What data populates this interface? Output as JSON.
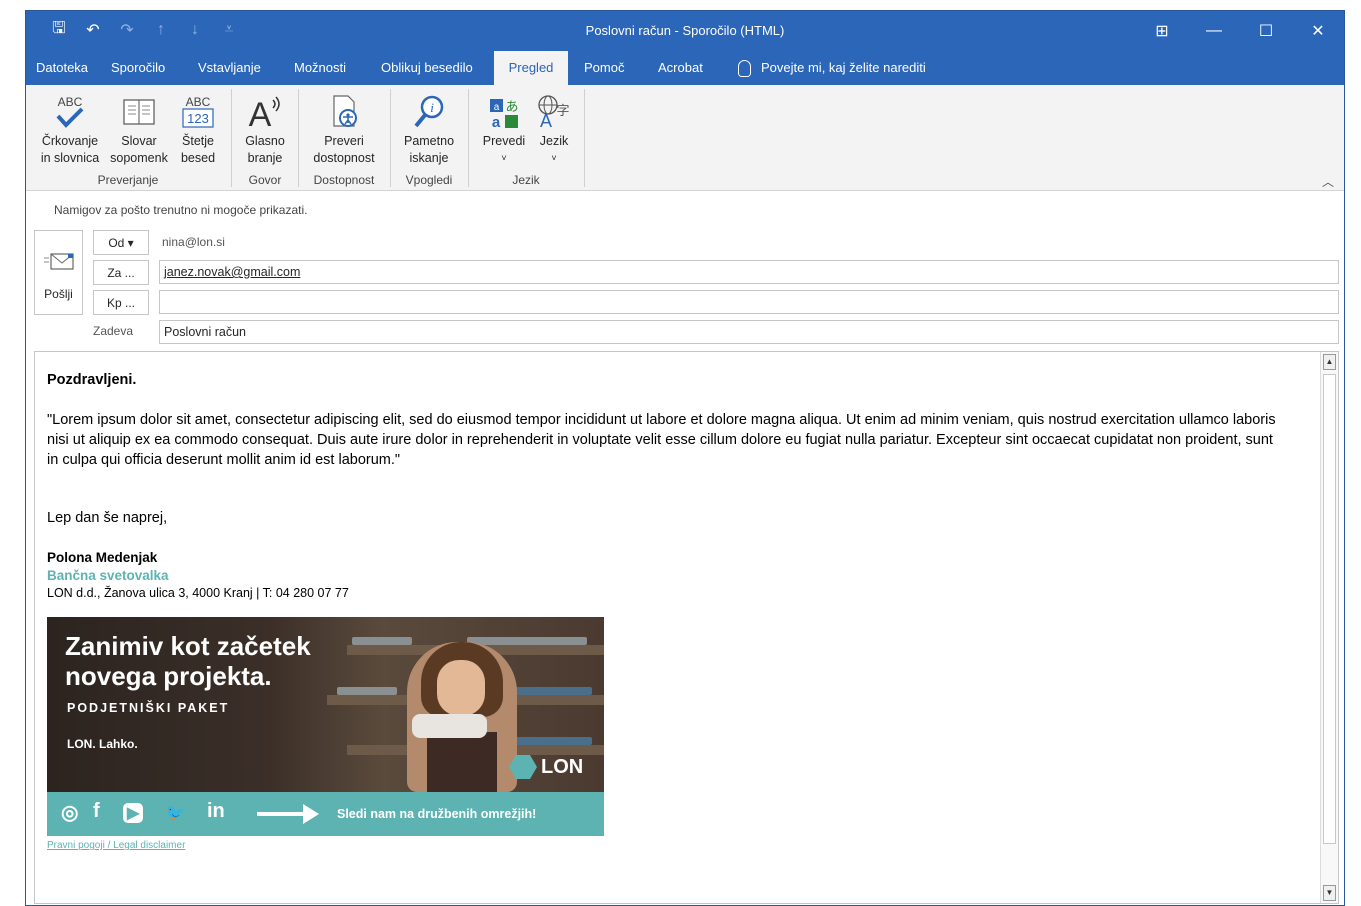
{
  "window": {
    "title": "Poslovni račun  -  Sporočilo (HTML)",
    "controls": {
      "ribbon_display": "⊞",
      "minimize": "—",
      "maximize": "☐",
      "close": "✕"
    }
  },
  "qat": {
    "save": "🖫",
    "undo": "↶",
    "redo": "↷",
    "up": "↑",
    "down": "↓",
    "customize": "⩡"
  },
  "tabs": [
    "Datoteka",
    "Sporočilo",
    "Vstavljanje",
    "Možnosti",
    "Oblikuj besedilo",
    "Pregled",
    "Pomoč",
    "Acrobat"
  ],
  "active_tab": "Pregled",
  "tell_me": "Povejte mi, kaj želite narediti",
  "ribbon": {
    "spelling": {
      "line1": "Črkovanje",
      "line2": "in slovnica",
      "icon_text": "ABC"
    },
    "thesaurus": {
      "line1": "Slovar",
      "line2": "sopomenk"
    },
    "wordcount": {
      "line1": "Štetje",
      "line2": "besed",
      "icon_top": "ABC",
      "icon_bottom": "123"
    },
    "readaloud": {
      "line1": "Glasno",
      "line2": "branje",
      "icon_text": "A"
    },
    "accessibility": {
      "line1": "Preveri",
      "line2": "dostopnost"
    },
    "smartlookup": {
      "line1": "Pametno",
      "line2": "iskanje"
    },
    "translate": {
      "line1": "Prevedi",
      "line2": "˅"
    },
    "language": {
      "line1": "Jezik",
      "line2": "˅"
    },
    "groups": {
      "proofing": "Preverjanje",
      "speech": "Govor",
      "accessibility": "Dostopnost",
      "insights": "Vpogledi",
      "language": "Jezik"
    }
  },
  "compose": {
    "info": "Namigov za pošto trenutno ni mogoče prikazati.",
    "send_label": "Pošlji",
    "from_label": "Od ▾",
    "from_value": "nina@lon.si",
    "to_label": "Za ...",
    "to_value": "janez.novak@gmail.com",
    "cc_label": "Kp ...",
    "cc_value": "",
    "subject_label": "Zadeva",
    "subject_value": "Poslovni račun"
  },
  "body": {
    "greeting": "Pozdravljeni.",
    "text": "\"Lorem ipsum dolor sit amet, consectetur adipiscing elit, sed do eiusmod tempor incididunt ut labore et dolore magna aliqua. Ut enim ad minim veniam, quis nostrud exercitation ullamco laboris nisi ut aliquip ex ea commodo consequat. Duis aute irure dolor in reprehenderit in voluptate velit esse cillum dolore eu fugiat nulla pariatur. Excepteur sint occaecat cupidatat non proident, sunt in culpa qui officia deserunt mollit anim id est laborum.\"",
    "closing": "Lep dan še naprej,",
    "signature": {
      "name": "Polona Medenjak",
      "role": "Bančna svetovalka",
      "address": "LON d.d., Žanova ulica 3, 4000 Kranj  | T: 04 280 07 77"
    },
    "banner": {
      "headline1": "Zanimiv kot začetek",
      "headline2": "novega projekta.",
      "subtitle": "PODJETNIŠKI PAKET",
      "tagline": "LON. Lahko.",
      "logo": "LON",
      "social": {
        "instagram": "◎",
        "facebook": "f",
        "youtube": "▶",
        "twitter": "🐦",
        "linkedin": "in"
      },
      "cta": "Sledi nam na družbenih omrežjih!"
    },
    "legal": "Pravni pogoji / Legal disclaimer"
  },
  "colors": {
    "accent": "#2b66b8",
    "brand_teal": "#5db3b1"
  }
}
